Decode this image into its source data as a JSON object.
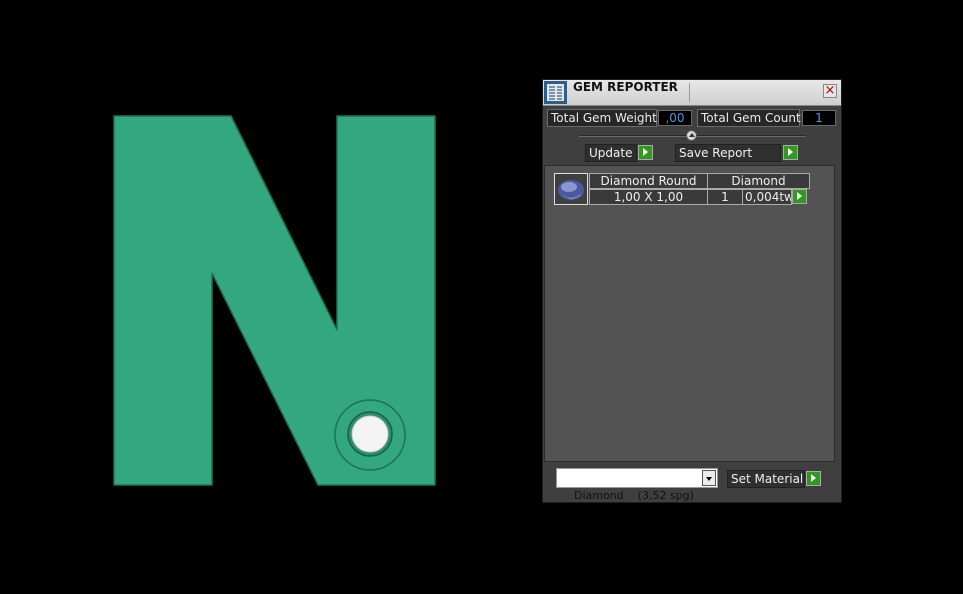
{
  "viewport": {
    "background": "#000000",
    "model_color": "#33a880",
    "model_outline": "#207055",
    "gem_color": "#ffffff"
  },
  "panel": {
    "title": "GEM REPORTER",
    "title_icon": "gem-reporter-icon",
    "close_label": "×",
    "total_weight_label": "Total Gem Weight",
    "total_weight_value": ",00",
    "total_count_label": "Total Gem Count",
    "total_count_value": "1",
    "update_label": "Update",
    "save_report_label": "Save Report",
    "gem_rows": [
      {
        "thumbnail": "diamond-gem-icon",
        "name": "Diamond Round",
        "material": "Diamond",
        "size": "1,00 X 1,00",
        "count": "1",
        "weight": "0,004tw"
      }
    ],
    "material_select": {
      "value": "Diamond    (3,52 spg)"
    },
    "set_material_label": "Set Material",
    "accent_green": "#2f9a1e",
    "value_blue": "#5a90e6"
  }
}
